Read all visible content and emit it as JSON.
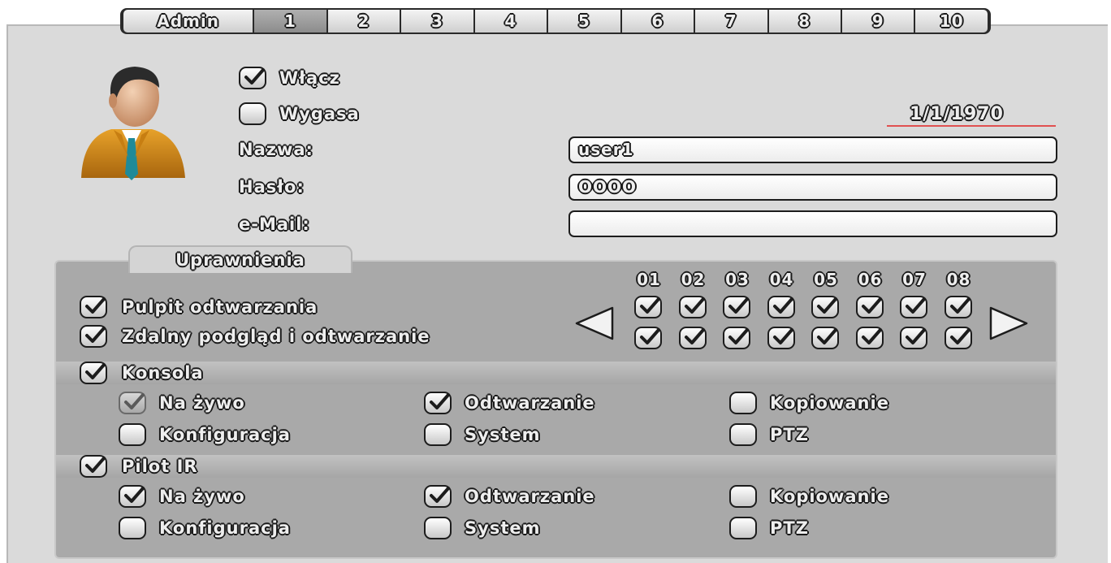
{
  "tabs": [
    {
      "label": "Admin",
      "active": false
    },
    {
      "label": "1",
      "active": true
    },
    {
      "label": "2",
      "active": false
    },
    {
      "label": "3",
      "active": false
    },
    {
      "label": "4",
      "active": false
    },
    {
      "label": "5",
      "active": false
    },
    {
      "label": "6",
      "active": false
    },
    {
      "label": "7",
      "active": false
    },
    {
      "label": "8",
      "active": false
    },
    {
      "label": "9",
      "active": false
    },
    {
      "label": "10",
      "active": false
    }
  ],
  "user": {
    "enable": {
      "label": "Włącz",
      "checked": true
    },
    "expires": {
      "label": "Wygasa",
      "checked": false
    },
    "expiry_date": "1/1/1970",
    "name_label": "Nazwa:",
    "name_value": "user1",
    "password_label": "Hasło:",
    "password_value": "OOOO",
    "email_label": "e-Mail:",
    "email_value": ""
  },
  "permissions": {
    "tab_label": "Uprawnienia",
    "playback_desktop": {
      "label": "Pulpit odtwarzania",
      "checked": true
    },
    "remote_view": {
      "label": "Zdalny podgląd i odtwarzanie",
      "checked": true
    },
    "channels": [
      "01",
      "02",
      "03",
      "04",
      "05",
      "06",
      "07",
      "08"
    ],
    "console": {
      "label": "Konsola",
      "checked": true,
      "items": [
        {
          "label": "Na żywo",
          "checked": true,
          "dim": true
        },
        {
          "label": "Odtwarzanie",
          "checked": true
        },
        {
          "label": "Kopiowanie",
          "checked": false
        },
        {
          "label": "Konfiguracja",
          "checked": false
        },
        {
          "label": "System",
          "checked": false
        },
        {
          "label": "PTZ",
          "checked": false
        }
      ]
    },
    "ir_remote": {
      "label": "Pilot IR",
      "checked": true,
      "items": [
        {
          "label": "Na żywo",
          "checked": true
        },
        {
          "label": "Odtwarzanie",
          "checked": true
        },
        {
          "label": "Kopiowanie",
          "checked": false
        },
        {
          "label": "Konfiguracja",
          "checked": false
        },
        {
          "label": "System",
          "checked": false
        },
        {
          "label": "PTZ",
          "checked": false
        }
      ]
    }
  },
  "colors": {
    "panel": "#dadada",
    "perm_box": "#a9a9a9",
    "date_underline": "#e05050"
  },
  "icons": {
    "avatar": "user-avatar-icon",
    "prev": "left-arrow-icon",
    "next": "right-arrow-icon",
    "check": "checkmark-icon"
  }
}
